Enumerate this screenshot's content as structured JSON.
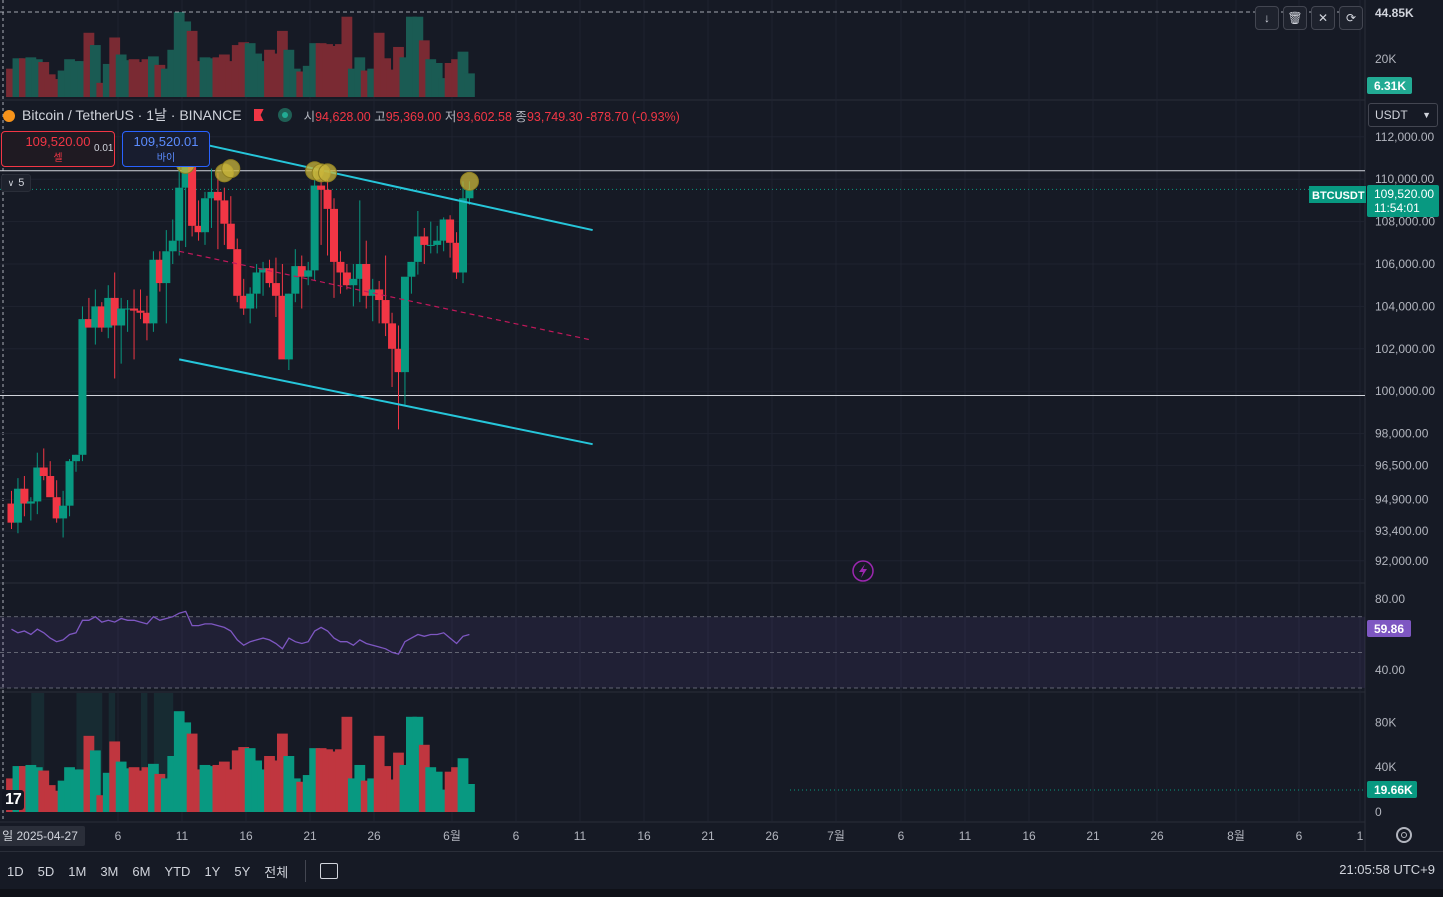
{
  "header": {
    "symbol_title": "Bitcoin / TetherUS · 1날 · BINANCE",
    "open_label": "시",
    "open_value": "94,628.00",
    "high_label": "고",
    "high_value": "95,369.00",
    "low_label": "저",
    "low_value": "93,602.58",
    "close_label": "종",
    "close_value": "93,749.30",
    "change": "-878.70 (-0.93%)"
  },
  "trade_panel": {
    "sell_price": "109,520.00",
    "sell_label": "셀",
    "spread": "0.01",
    "buy_price": "109,520.01",
    "buy_label": "바이"
  },
  "collapse_count": "5",
  "currency_select": "USDT",
  "toolbar_icons": [
    "arrow-down-icon",
    "trash-icon",
    "collapse-icon",
    "loop-icon"
  ],
  "bottom_bar": {
    "ranges": [
      "1D",
      "5D",
      "1M",
      "3M",
      "6M",
      "YTD",
      "1Y",
      "5Y",
      "전체"
    ],
    "clock": "21:05:58 UTC+9"
  },
  "tv_logo": "17",
  "colors": {
    "up": "#089981",
    "down": "#f23645",
    "channel": "#26c6da",
    "rsi": "#7e57c2",
    "marker": "#c9b53b"
  },
  "chart_data": [
    {
      "type": "candlestick",
      "symbol": "BTCUSDT",
      "ylim": [
        91000,
        113500
      ],
      "y_ticks": [
        {
          "v": 112000,
          "label": "112,000.00"
        },
        {
          "v": 110000,
          "label": "110,000.00"
        },
        {
          "v": 108000,
          "label": "108,000.00"
        },
        {
          "v": 106000,
          "label": "106,000.00"
        },
        {
          "v": 104000,
          "label": "104,000.00"
        },
        {
          "v": 102000,
          "label": "102,000.00"
        },
        {
          "v": 100000,
          "label": "100,000.00"
        },
        {
          "v": 98000,
          "label": "98,000.00"
        },
        {
          "v": 96500,
          "label": "96,500.00"
        },
        {
          "v": 94900,
          "label": "94,900.00"
        },
        {
          "v": 93400,
          "label": "93,400.00"
        },
        {
          "v": 92000,
          "label": "92,000.00"
        }
      ],
      "last_price_label": "BTCUSDT",
      "last_price": "109,520.00",
      "countdown": "11:54:01",
      "x_tick_labels": [
        "일 2025-04-27",
        "6",
        "11",
        "16",
        "21",
        "26",
        "6월",
        "6",
        "11",
        "16",
        "21",
        "26",
        "7월",
        "6",
        "11",
        "16",
        "21",
        "26",
        "8월",
        "6",
        "1"
      ],
      "candles": [
        [
          94700,
          95300,
          93500,
          93800
        ],
        [
          93800,
          95900,
          93300,
          95400
        ],
        [
          95400,
          96000,
          94100,
          94700
        ],
        [
          94700,
          95000,
          93900,
          94800
        ],
        [
          94800,
          97100,
          94200,
          96400
        ],
        [
          96400,
          97300,
          95800,
          96000
        ],
        [
          96000,
          96700,
          95600,
          95000
        ],
        [
          95000,
          95800,
          93800,
          94000
        ],
        [
          94000,
          95300,
          93100,
          94600
        ],
        [
          94600,
          96800,
          94100,
          96700
        ],
        [
          96700,
          97000,
          96200,
          97000
        ],
        [
          97000,
          104000,
          96700,
          103400
        ],
        [
          103400,
          104400,
          103100,
          103000
        ],
        [
          103000,
          104800,
          102200,
          104000
        ],
        [
          104000,
          104200,
          102800,
          103000
        ],
        [
          103000,
          105000,
          102500,
          104400
        ],
        [
          104400,
          105600,
          100600,
          103100
        ],
        [
          103100,
          104400,
          101300,
          103900
        ],
        [
          103900,
          104300,
          102800,
          103900
        ],
        [
          103900,
          104800,
          101500,
          103800
        ],
        [
          103800,
          104800,
          103400,
          103700
        ],
        [
          103700,
          104500,
          102400,
          103200
        ],
        [
          103200,
          106600,
          102800,
          106200
        ],
        [
          106200,
          106600,
          104700,
          105100
        ],
        [
          105100,
          107600,
          103200,
          106600
        ],
        [
          106600,
          108100,
          106000,
          107100
        ],
        [
          107100,
          110600,
          106400,
          109600
        ],
        [
          109600,
          111900,
          106800,
          111000
        ],
        [
          111000,
          111800,
          107300,
          107800
        ],
        [
          107800,
          109000,
          107100,
          107500
        ],
        [
          107500,
          109400,
          106900,
          109100
        ],
        [
          109100,
          110500,
          107700,
          109400
        ],
        [
          109400,
          110300,
          106700,
          109000
        ],
        [
          109000,
          109600,
          106900,
          107900
        ],
        [
          107900,
          109200,
          107100,
          106700
        ],
        [
          106700,
          107200,
          104200,
          104500
        ],
        [
          104500,
          105300,
          103600,
          103900
        ],
        [
          103900,
          104900,
          103200,
          104600
        ],
        [
          104600,
          106000,
          103900,
          105600
        ],
        [
          105600,
          106100,
          104500,
          105800
        ],
        [
          105800,
          106200,
          104900,
          105100
        ],
        [
          105100,
          106300,
          103500,
          104500
        ],
        [
          104500,
          106000,
          102600,
          101500
        ],
        [
          101500,
          104600,
          101000,
          104600
        ],
        [
          104600,
          106700,
          104200,
          105900
        ],
        [
          105900,
          106400,
          103900,
          105400
        ],
        [
          105400,
          106100,
          105000,
          105700
        ],
        [
          105700,
          110500,
          105200,
          109700
        ],
        [
          109700,
          110300,
          106900,
          109500
        ],
        [
          109500,
          110000,
          106400,
          108600
        ],
        [
          108600,
          109100,
          104400,
          106100
        ],
        [
          106100,
          106600,
          104600,
          105600
        ],
        [
          105600,
          106000,
          104800,
          105000
        ],
        [
          105000,
          106000,
          104000,
          105300
        ],
        [
          105300,
          109000,
          104200,
          106000
        ],
        [
          106000,
          107100,
          103900,
          104500
        ],
        [
          104500,
          105300,
          103300,
          104800
        ],
        [
          104800,
          105200,
          103200,
          104300
        ],
        [
          104300,
          106400,
          102600,
          103200
        ],
        [
          103200,
          103700,
          100200,
          102000
        ],
        [
          102000,
          103100,
          98200,
          100900
        ],
        [
          100900,
          105000,
          99300,
          105400
        ],
        [
          105400,
          106100,
          104600,
          106100
        ],
        [
          106100,
          108500,
          105500,
          107300
        ],
        [
          107300,
          107700,
          106000,
          106900
        ],
        [
          106900,
          108000,
          106500,
          106900
        ],
        [
          106900,
          107800,
          106500,
          107100
        ],
        [
          107100,
          108200,
          106600,
          108100
        ],
        [
          108100,
          108300,
          106300,
          107000
        ],
        [
          107000,
          107500,
          105300,
          105600
        ],
        [
          105600,
          109900,
          105100,
          109100
        ],
        [
          109100,
          109900,
          108800,
          109520
        ]
      ],
      "markers": [
        {
          "index": 27,
          "price": 110700
        },
        {
          "index": 33,
          "price": 110300
        },
        {
          "index": 34,
          "price": 110500
        },
        {
          "index": 47,
          "price": 110400
        },
        {
          "index": 48,
          "price": 110300
        },
        {
          "index": 49,
          "price": 110300
        },
        {
          "index": 71,
          "price": 109900
        }
      ],
      "horizontal_lines": [
        110400,
        99800
      ],
      "channel_upper": [
        [
          26,
          111900
        ],
        [
          87,
          107600
        ]
      ],
      "channel_mid": [
        [
          26,
          106600
        ],
        [
          87,
          102400
        ]
      ],
      "channel_lower": [
        [
          26,
          101500
        ],
        [
          87,
          97500
        ]
      ]
    },
    {
      "type": "bar",
      "name": "overlay volume",
      "axis_labels": [
        "44.85K",
        "20K"
      ],
      "current_badge": "6.31K"
    },
    {
      "type": "line",
      "name": "RSI",
      "ylim": [
        30,
        85
      ],
      "levels": [
        70,
        50,
        30
      ],
      "axis_labels": [
        "80.00",
        "40.00"
      ],
      "current_badge": "59.86",
      "values": [
        63,
        61,
        62,
        60,
        63,
        61,
        58,
        56,
        57,
        60,
        61,
        68,
        68,
        70,
        67,
        68,
        67,
        69,
        68,
        68,
        67,
        66,
        70,
        68,
        69,
        70,
        72,
        73,
        65,
        65,
        66,
        66,
        65,
        64,
        62,
        57,
        54,
        56,
        57,
        58,
        57,
        55,
        52,
        58,
        56,
        55,
        56,
        62,
        64,
        62,
        58,
        56,
        56,
        54,
        57,
        55,
        54,
        53,
        52,
        50,
        49,
        56,
        58,
        60,
        59,
        60,
        60,
        61,
        58,
        55,
        59,
        60
      ]
    },
    {
      "type": "bar",
      "name": "Volume",
      "ylim": [
        0,
        100000
      ],
      "axis_labels": [
        {
          "v": 80000,
          "label": "80K"
        },
        {
          "v": 40000,
          "label": "40K"
        },
        {
          "v": 0,
          "label": "0"
        }
      ],
      "current_badge": "19.66K",
      "current_value": 19660,
      "values": [
        30000,
        41000,
        41000,
        42000,
        40000,
        37000,
        24000,
        19000,
        28000,
        40000,
        38000,
        38000,
        68000,
        55000,
        15000,
        35000,
        63000,
        45000,
        39000,
        40000,
        37000,
        40000,
        43000,
        34000,
        30000,
        50000,
        90000,
        80000,
        70000,
        38000,
        42000,
        41000,
        42000,
        45000,
        38000,
        55000,
        58000,
        57000,
        46000,
        38000,
        50000,
        46000,
        70000,
        50000,
        30000,
        27000,
        33000,
        57000,
        57000,
        56000,
        54000,
        56000,
        85000,
        30000,
        42000,
        28000,
        30000,
        68000,
        41000,
        29000,
        53000,
        42000,
        85000,
        85000,
        60000,
        40000,
        36000,
        20000,
        36000,
        40000,
        48000,
        25000
      ],
      "shaded_ranges": [
        [
          4,
          5
        ],
        [
          11,
          14
        ],
        [
          16,
          16
        ],
        [
          21,
          21
        ],
        [
          23,
          25
        ]
      ]
    }
  ]
}
